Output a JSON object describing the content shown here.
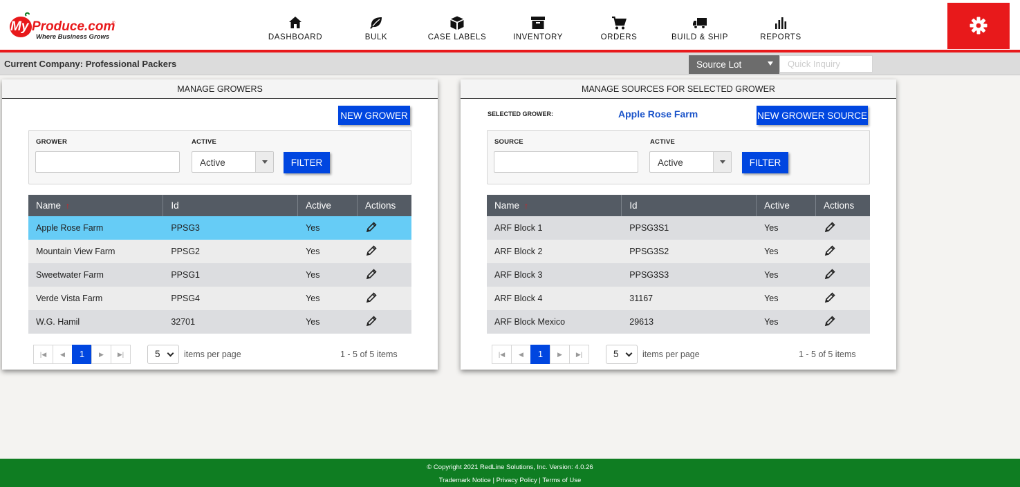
{
  "header": {
    "brand": "MyProduce.com",
    "tagline": "Where Business Grows",
    "nav": [
      {
        "label": "DASHBOARD",
        "icon": "home-icon"
      },
      {
        "label": "BULK",
        "icon": "leaf-icon"
      },
      {
        "label": "CASE LABELS",
        "icon": "box-icon"
      },
      {
        "label": "INVENTORY",
        "icon": "archive-icon"
      },
      {
        "label": "ORDERS",
        "icon": "cart-icon"
      },
      {
        "label": "BUILD & SHIP",
        "icon": "truck-icon"
      },
      {
        "label": "REPORTS",
        "icon": "bar-chart-icon"
      }
    ],
    "settings_icon": "gear-icon"
  },
  "company_bar": {
    "current_company": "Current Company: Professional Packers",
    "search_type": "Source Lot",
    "quick_inquiry_placeholder": "Quick Inquiry"
  },
  "growers_panel": {
    "title": "MANAGE GROWERS",
    "new_button": "NEW GROWER",
    "filter": {
      "field_label": "GROWER",
      "field_value": "",
      "active_label": "ACTIVE",
      "active_value": "Active",
      "filter_button": "FILTER"
    },
    "columns": [
      "Name",
      "Id",
      "Active",
      "Actions"
    ],
    "rows": [
      {
        "name": "Apple Rose Farm",
        "id": "PPSG3",
        "active": "Yes"
      },
      {
        "name": "Mountain View Farm",
        "id": "PPSG2",
        "active": "Yes"
      },
      {
        "name": "Sweetwater Farm",
        "id": "PPSG1",
        "active": "Yes"
      },
      {
        "name": "Verde Vista Farm",
        "id": "PPSG4",
        "active": "Yes"
      },
      {
        "name": "W.G. Hamil",
        "id": "32701",
        "active": "Yes"
      }
    ],
    "pager": {
      "current_page": "1",
      "page_size": "5",
      "page_size_label": "items per page",
      "summary": "1 - 5 of 5 items"
    }
  },
  "sources_panel": {
    "title": "MANAGE SOURCES FOR SELECTED GROWER",
    "selected_grower_label": "SELECTED GROWER:",
    "selected_grower": "Apple Rose Farm",
    "new_button": "NEW GROWER SOURCE",
    "filter": {
      "field_label": "SOURCE",
      "field_value": "",
      "active_label": "ACTIVE",
      "active_value": "Active",
      "filter_button": "FILTER"
    },
    "columns": [
      "Name",
      "Id",
      "Active",
      "Actions"
    ],
    "rows": [
      {
        "name": "ARF Block 1",
        "id": "PPSG3S1",
        "active": "Yes"
      },
      {
        "name": "ARF Block 2",
        "id": "PPSG3S2",
        "active": "Yes"
      },
      {
        "name": "ARF Block 3",
        "id": "PPSG3S3",
        "active": "Yes"
      },
      {
        "name": "ARF Block 4",
        "id": "31167",
        "active": "Yes"
      },
      {
        "name": "ARF Block Mexico",
        "id": "29613",
        "active": "Yes"
      }
    ],
    "pager": {
      "current_page": "1",
      "page_size": "5",
      "page_size_label": "items per page",
      "summary": "1 - 5 of 5 items"
    }
  },
  "footer": {
    "copyright": "© Copyright 2021 RedLine Solutions, Inc. Version: 4.0.26",
    "trademark": "Trademark Notice",
    "privacy": "Privacy Policy",
    "terms": "Terms of Use",
    "separator": " | "
  },
  "colors": {
    "accent_red": "#e8191b",
    "button_blue": "#0046e0",
    "selected_row": "#66ccf6",
    "footer_green": "#0f7d22",
    "table_header": "#545b64"
  }
}
